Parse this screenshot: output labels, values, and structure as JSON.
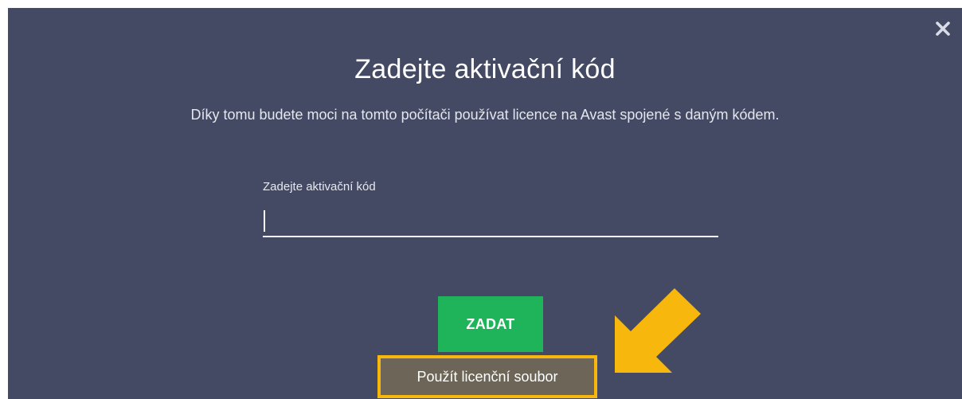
{
  "dialog": {
    "close_glyph": "×",
    "title": "Zadejte aktivační kód",
    "subtitle": "Díky tomu budete moci na tomto počítači používat licence na Avast spojené s daným kódem.",
    "field": {
      "label": "Zadejte aktivační kód",
      "value": ""
    },
    "submit_label": "ZADAT",
    "license_file_label": "Použít licenční soubor"
  },
  "colors": {
    "background": "#444a63",
    "submit": "#1fb45a",
    "highlight": "#f8b70d",
    "license_bg": "#6d6658"
  },
  "icons": {
    "close": "close-icon",
    "annotation": "arrow-icon"
  }
}
